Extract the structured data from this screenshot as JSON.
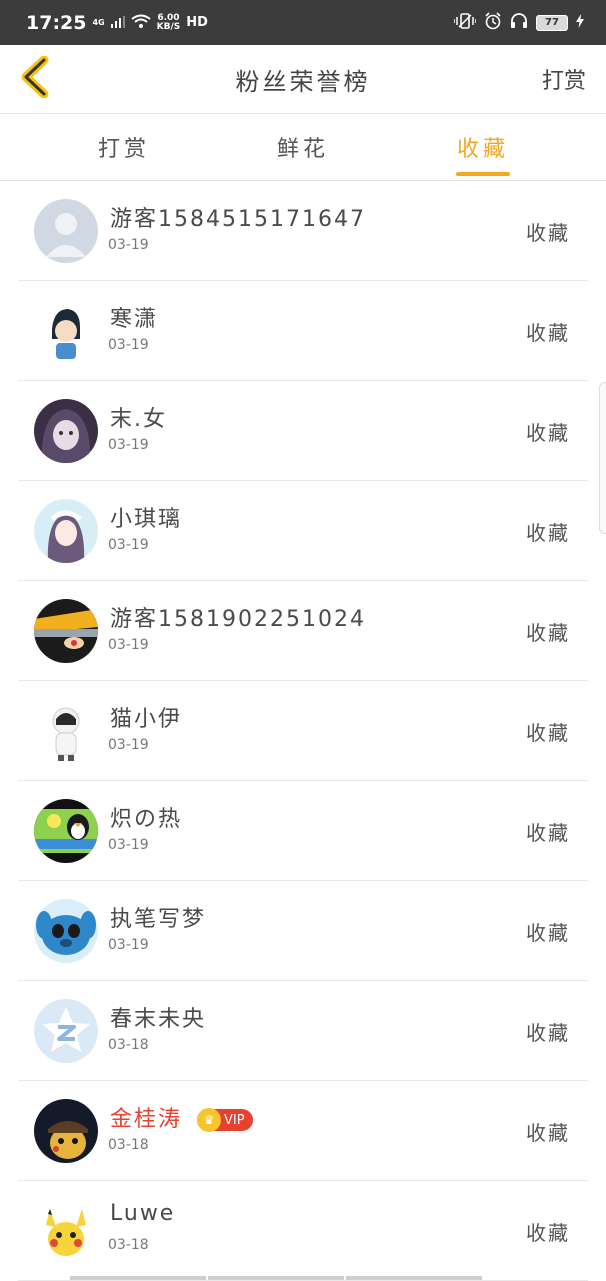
{
  "status_bar": {
    "time": "17:25",
    "network": "4G",
    "speed_value": "6.00",
    "speed_unit": "KB/S",
    "hd": "HD",
    "battery": "77"
  },
  "header": {
    "title": "粉丝荣誉榜",
    "action": "打赏"
  },
  "tabs": [
    {
      "label": "打赏",
      "active": false
    },
    {
      "label": "鲜花",
      "active": false
    },
    {
      "label": "收藏",
      "active": true
    }
  ],
  "accent_color": "#f5a623",
  "vip_color": "#e8412f",
  "list": [
    {
      "name": "游客1584515171647",
      "date": "03-19",
      "action": "收藏",
      "avatar": "default-avatar"
    },
    {
      "name": "寒潇",
      "date": "03-19",
      "action": "收藏",
      "avatar": "anime-boy-avatar"
    },
    {
      "name": "末.女",
      "date": "03-19",
      "action": "收藏",
      "avatar": "dark-hair-girl-avatar"
    },
    {
      "name": "小琪璃",
      "date": "03-19",
      "action": "收藏",
      "avatar": "anime-girl-avatar"
    },
    {
      "name": "游客1581902251024",
      "date": "03-19",
      "action": "收藏",
      "avatar": "ninja-avatar"
    },
    {
      "name": "猫小伊",
      "date": "03-19",
      "action": "收藏",
      "avatar": "chibi-avatar"
    },
    {
      "name": "炽の热",
      "date": "03-19",
      "action": "收藏",
      "avatar": "penguin-avatar"
    },
    {
      "name": "执笔写梦",
      "date": "03-19",
      "action": "收藏",
      "avatar": "stitch-avatar"
    },
    {
      "name": "春末未央",
      "date": "03-18",
      "action": "收藏",
      "avatar": "qzone-star-avatar"
    },
    {
      "name": "金桂涛",
      "date": "03-18",
      "action": "收藏",
      "avatar": "pikachu-detective-avatar",
      "vip": true,
      "vip_label": "VIP"
    },
    {
      "name": "Luwe",
      "date": "03-18",
      "action": "收藏",
      "avatar": "pikachu-avatar"
    }
  ]
}
